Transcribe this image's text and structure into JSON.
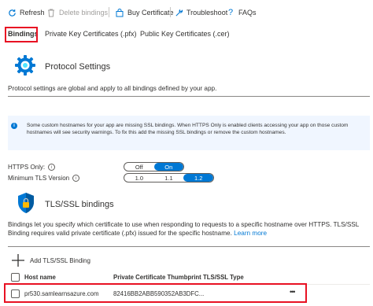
{
  "toolbar": {
    "refresh": "Refresh",
    "delete_bindings": "Delete bindings",
    "buy_certificate": "Buy Certificate",
    "troubleshoot": "Troubleshoot",
    "faqs": "FAQs"
  },
  "tabs": [
    {
      "label": "Bindings",
      "active": true
    },
    {
      "label": "Private Key Certificates (.pfx)",
      "active": false
    },
    {
      "label": "Public Key Certificates (.cer)",
      "active": false
    }
  ],
  "protocol": {
    "title": "Protocol Settings",
    "description": "Protocol settings are global and apply to all bindings defined by your app."
  },
  "info_banner": {
    "text": "Some custom hostnames for your app are missing SSL bindings. When HTTPS Only is enabled clients accessing your app on those custom hostnames will see security warnings. To fix this add the missing SSL bindings or remove the custom hostnames."
  },
  "https_only": {
    "label": "HTTPS Only:",
    "options": [
      "Off",
      "On"
    ],
    "selected": "On"
  },
  "min_tls": {
    "label": "Minimum TLS Version",
    "options": [
      "1.0",
      "1.1",
      "1.2"
    ],
    "selected": "1.2"
  },
  "tls_bindings": {
    "title": "TLS/SSL bindings",
    "description": "Bindings let you specify which certificate to use when responding to requests to a specific hostname over HTTPS. TLS/SSL Binding requires valid private certificate (.pfx) issued for the specific hostname.",
    "learn_more": "Learn more",
    "add_label": "Add TLS/SSL Binding"
  },
  "table": {
    "headers": [
      "Host name",
      "Private Certificate Thumbprint",
      "TLS/SSL Type"
    ],
    "rows": [
      {
        "host": "pr530.samlearnsazure.com",
        "thumbprint": "82416BB2ABB590352AB3DFC...",
        "type": "",
        "more": "•••"
      }
    ]
  },
  "colors": {
    "accent": "#0078d4",
    "highlight": "#e81123",
    "banner": "#f0f6ff"
  }
}
